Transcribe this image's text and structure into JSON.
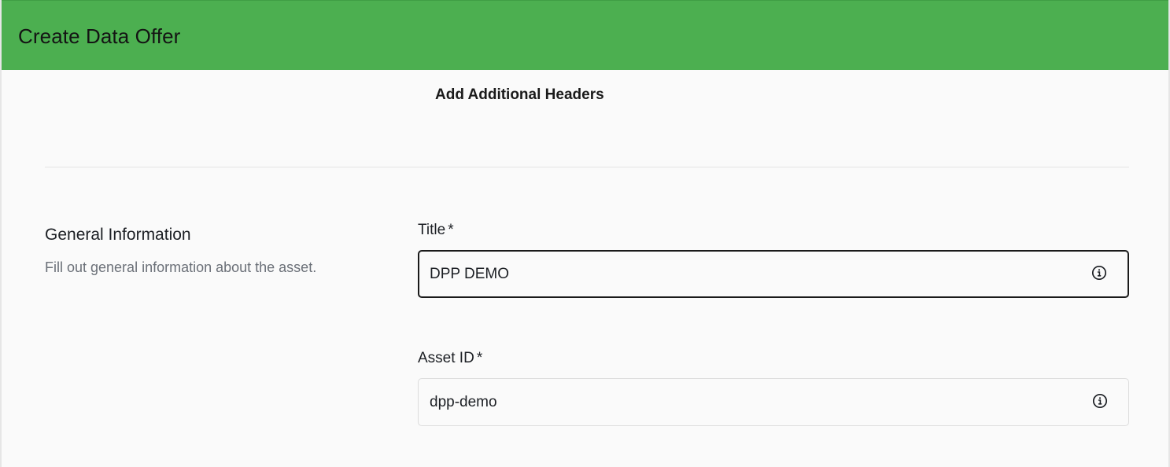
{
  "header": {
    "title": "Create Data Offer"
  },
  "actions": {
    "add_headers_label": "Add Additional Headers"
  },
  "general_section": {
    "title": "General Information",
    "description": "Fill out general information about the asset."
  },
  "fields": {
    "title": {
      "label": "Title",
      "required_marker": "*",
      "value": "DPP DEMO",
      "icon": "info-icon"
    },
    "asset_id": {
      "label": "Asset ID",
      "required_marker": "*",
      "value": "dpp-demo",
      "icon": "info-icon"
    }
  },
  "colors": {
    "header_bg": "#4caf50",
    "page_bg": "#fafafa",
    "focused_border": "#1a1a1a",
    "input_border": "#dcdcdc"
  }
}
